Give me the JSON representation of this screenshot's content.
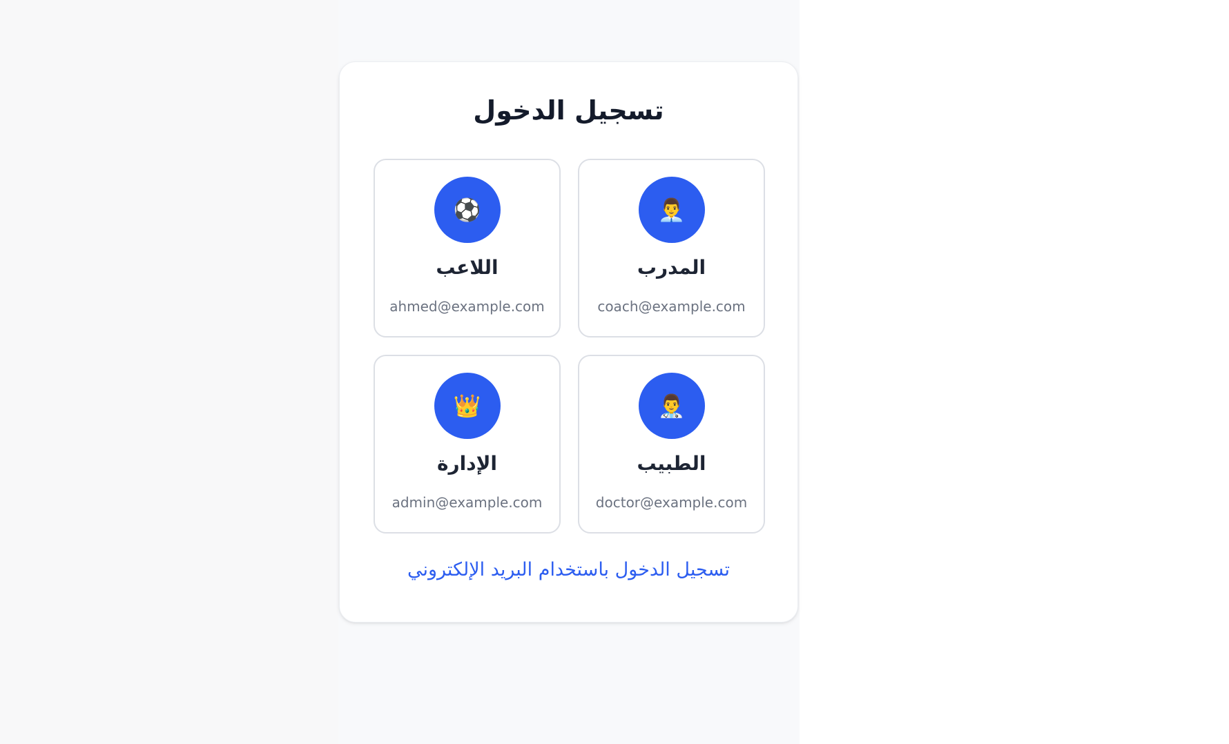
{
  "login": {
    "title": "تسجيل الدخول",
    "email_link": "تسجيل الدخول باستخدام البريد الإلكتروني",
    "roles": [
      {
        "name": "المدرب",
        "email": "coach@example.com",
        "icon": "👨‍💼",
        "icon_name": "coach-icon"
      },
      {
        "name": "اللاعب",
        "email": "ahmed@example.com",
        "icon": "⚽",
        "icon_name": "soccer-ball-icon"
      },
      {
        "name": "الطبيب",
        "email": "doctor@example.com",
        "icon": "👨‍⚕️",
        "icon_name": "doctor-icon"
      },
      {
        "name": "الإدارة",
        "email": "admin@example.com",
        "icon": "👑",
        "icon_name": "crown-icon"
      }
    ]
  },
  "colors": {
    "accent": "#2c5df0",
    "title": "#141b2b",
    "muted": "#6b7280",
    "border": "#dcdfe5"
  }
}
